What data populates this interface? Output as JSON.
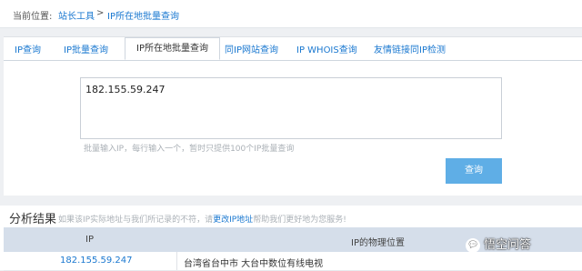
{
  "breadcrumb": {
    "label": "当前位置:",
    "link": "站长工具",
    "separator": ">",
    "current": "IP所在地批量查询"
  },
  "tabs": [
    {
      "label": "IP查询"
    },
    {
      "label": "IP批量查询"
    },
    {
      "label": "IP所在地批量查询"
    },
    {
      "label": "同IP网站查询"
    },
    {
      "label": "IP WHOIS查询"
    },
    {
      "label": "友情链接同IP检测"
    }
  ],
  "form": {
    "textarea_value": "182.155.59.247",
    "hint": "批量输入IP，每行输入一个，暂时只提供100个IP批量查询",
    "query_button": "查询"
  },
  "result": {
    "title": "分析结果",
    "note_before": "如果该IP实际地址与我们所记录的不符，请",
    "note_link": "更改IP地址",
    "note_after": "帮助我们更好地为您服务!",
    "columns": {
      "ip": "IP",
      "location": "IP的物理位置"
    },
    "rows": [
      {
        "ip": "182.155.59.247",
        "location": "台湾省台中市 大台中数位有线电视"
      }
    ]
  },
  "watermark": {
    "text": "悟空问答",
    "icon": "chat-bubble-icon"
  },
  "colors": {
    "link": "#1a78d0",
    "button": "#5faee6",
    "table_header": "#d5deea"
  }
}
